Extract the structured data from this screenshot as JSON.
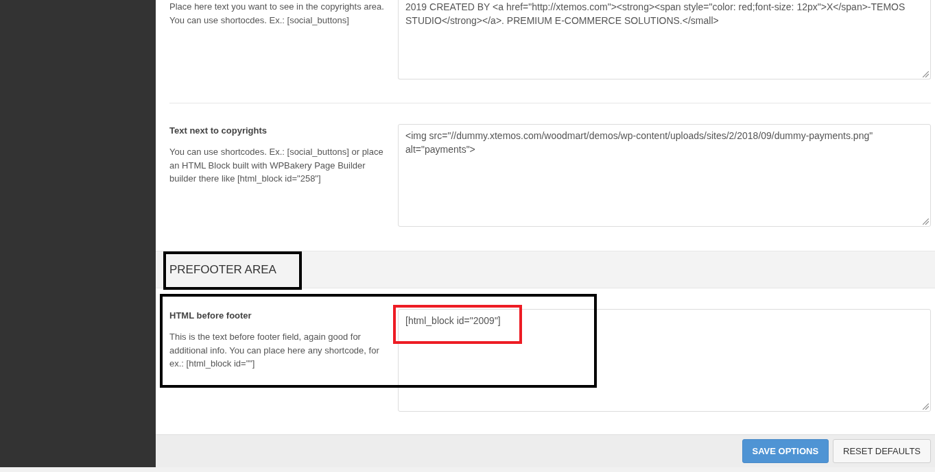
{
  "option_rows": [
    {
      "description": "Place here text you want to see in the copyrights area. You can use shortocdes. Ex.: [social_buttons]",
      "value": "2019 CREATED BY <a href=\"http://xtemos.com\"><strong><span style=\"color: red;font-size: 12px\">X</span>-TEMOS STUDIO</strong></a>. PREMIUM E-COMMERCE SOLUTIONS.</small>"
    },
    {
      "title": "Text next to copyrights",
      "description": "You can use shortcodes. Ex.: [social_buttons] or place an HTML Block built with WPBakery Page Builder builder there like [html_block id=\"258\"]",
      "value": "<img src=\"//dummy.xtemos.com/woodmart/demos/wp-content/uploads/sites/2/2018/09/dummy-payments.png\" alt=\"payments\">"
    }
  ],
  "section": {
    "title": "PREFOOTER AREA",
    "highlight": {
      "color": "#000000"
    },
    "rows": [
      {
        "title": "HTML before footer",
        "description": "This is the text before footer field, again good for additional info. You can place here any shortcode, for ex.: [html_block id=\"\"]",
        "value": "[html_block id=\"2009\"]",
        "highlight": {
          "color": "#000000"
        },
        "value_highlight": {
          "color": "#ed1c24"
        }
      }
    ]
  },
  "footer": {
    "buttons": [
      {
        "label": "SAVE OPTIONS",
        "kind": "primary"
      },
      {
        "label": "RESET DEFAULTS",
        "kind": "secondary"
      }
    ]
  }
}
